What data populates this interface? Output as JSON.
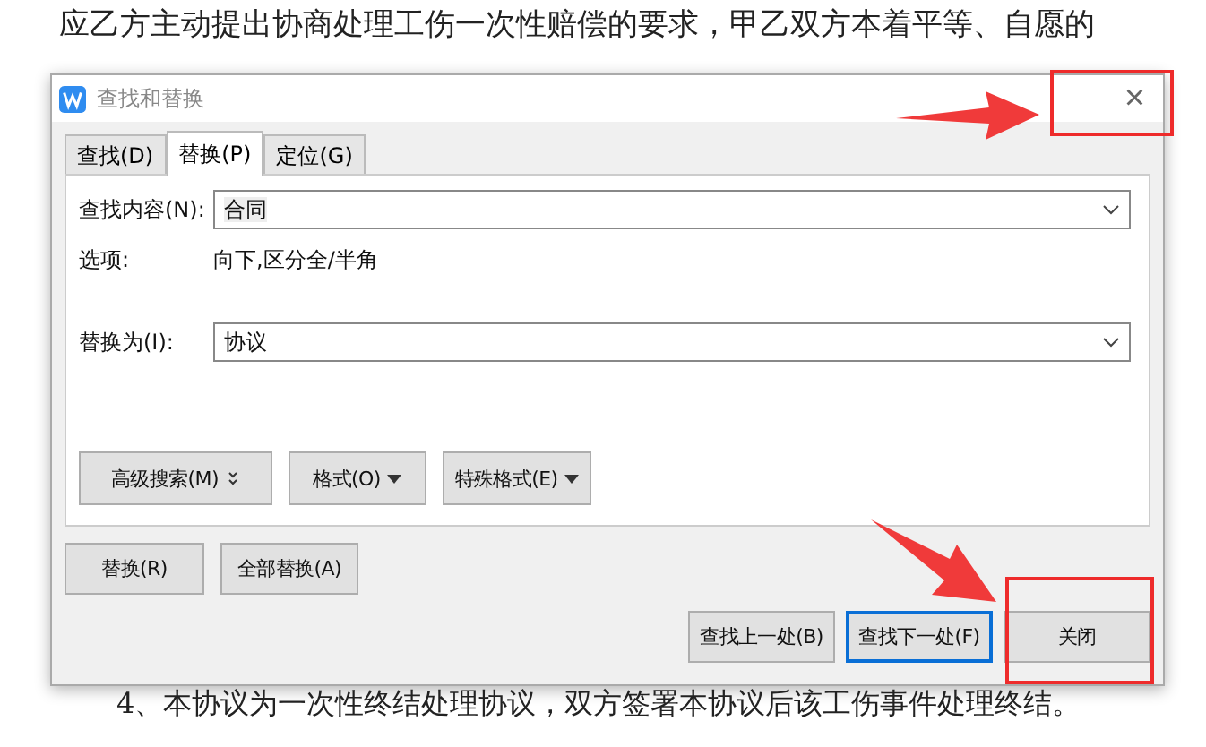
{
  "document": {
    "lines": [
      "应乙方主动提出协商处理工伤一次性赔偿的要求，甲乙双方本着平等、自愿的"
    ],
    "after": "4、本协议为一次性终结处理协议，双方签署本协议后该工伤事件处理终结。"
  },
  "window": {
    "title": "查找和替换",
    "close": "×"
  },
  "tabs": [
    {
      "label": "查找(D)",
      "selected": false
    },
    {
      "label": "替换(P)",
      "selected": true
    },
    {
      "label": "定位(G)",
      "selected": false
    }
  ],
  "find": {
    "label": "查找内容(N):",
    "value": "合同"
  },
  "options": {
    "label": "选项:",
    "value": "向下,区分全/半角"
  },
  "replace": {
    "label": "替换为(I):",
    "value": "协议"
  },
  "option_buttons": [
    "高级搜索(M)",
    "格式(O)",
    "特殊格式(E)"
  ],
  "replace_buttons": [
    "替换(R)",
    "全部替换(A)"
  ],
  "nav_buttons": [
    {
      "label": "查找上一处(B)",
      "focused": false
    },
    {
      "label": "查找下一处(F)",
      "focused": true
    },
    {
      "label": "关闭",
      "focused": false
    }
  ]
}
